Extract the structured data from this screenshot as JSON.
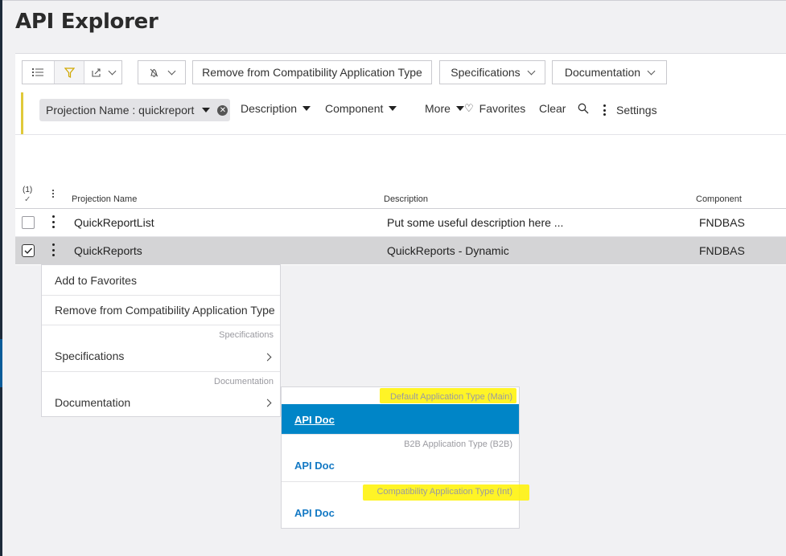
{
  "page": {
    "title": "API Explorer"
  },
  "toolbar": {
    "remove_label": "Remove from Compatibility Application Type",
    "specifications_label": "Specifications",
    "documentation_label": "Documentation"
  },
  "filterbar": {
    "chip_label": "Projection Name : quickreport",
    "description": "Description",
    "component": "Component",
    "more": "More",
    "favorites": "Favorites",
    "clear": "Clear",
    "settings": "Settings"
  },
  "table": {
    "selected_count": "(1)",
    "columns": [
      "Projection Name",
      "Description",
      "Component"
    ],
    "rows": [
      {
        "name": "QuickReportList",
        "description": "Put some useful description here ...",
        "component": "FNDBAS",
        "selected": false
      },
      {
        "name": "QuickReports",
        "description": "QuickReports - Dynamic",
        "component": "FNDBAS",
        "selected": true
      }
    ]
  },
  "context_menu": {
    "add_favorites": "Add to Favorites",
    "remove_compat": "Remove from Compatibility Application Type",
    "spec_group": "Specifications",
    "spec_item": "Specifications",
    "doc_group": "Documentation",
    "doc_item": "Documentation"
  },
  "submenu": {
    "groups": [
      {
        "title": "Default Application Type (Main)",
        "item": "API Doc"
      },
      {
        "title": "B2B Application Type (B2B)",
        "item": "API Doc"
      },
      {
        "title": "Compatibility Application Type (Int)",
        "item": "API Doc"
      }
    ]
  },
  "colors": {
    "accent": "#0085c7",
    "highlight": "#fff200",
    "filter_bar": "#e0c93a",
    "link": "#1479c4"
  }
}
